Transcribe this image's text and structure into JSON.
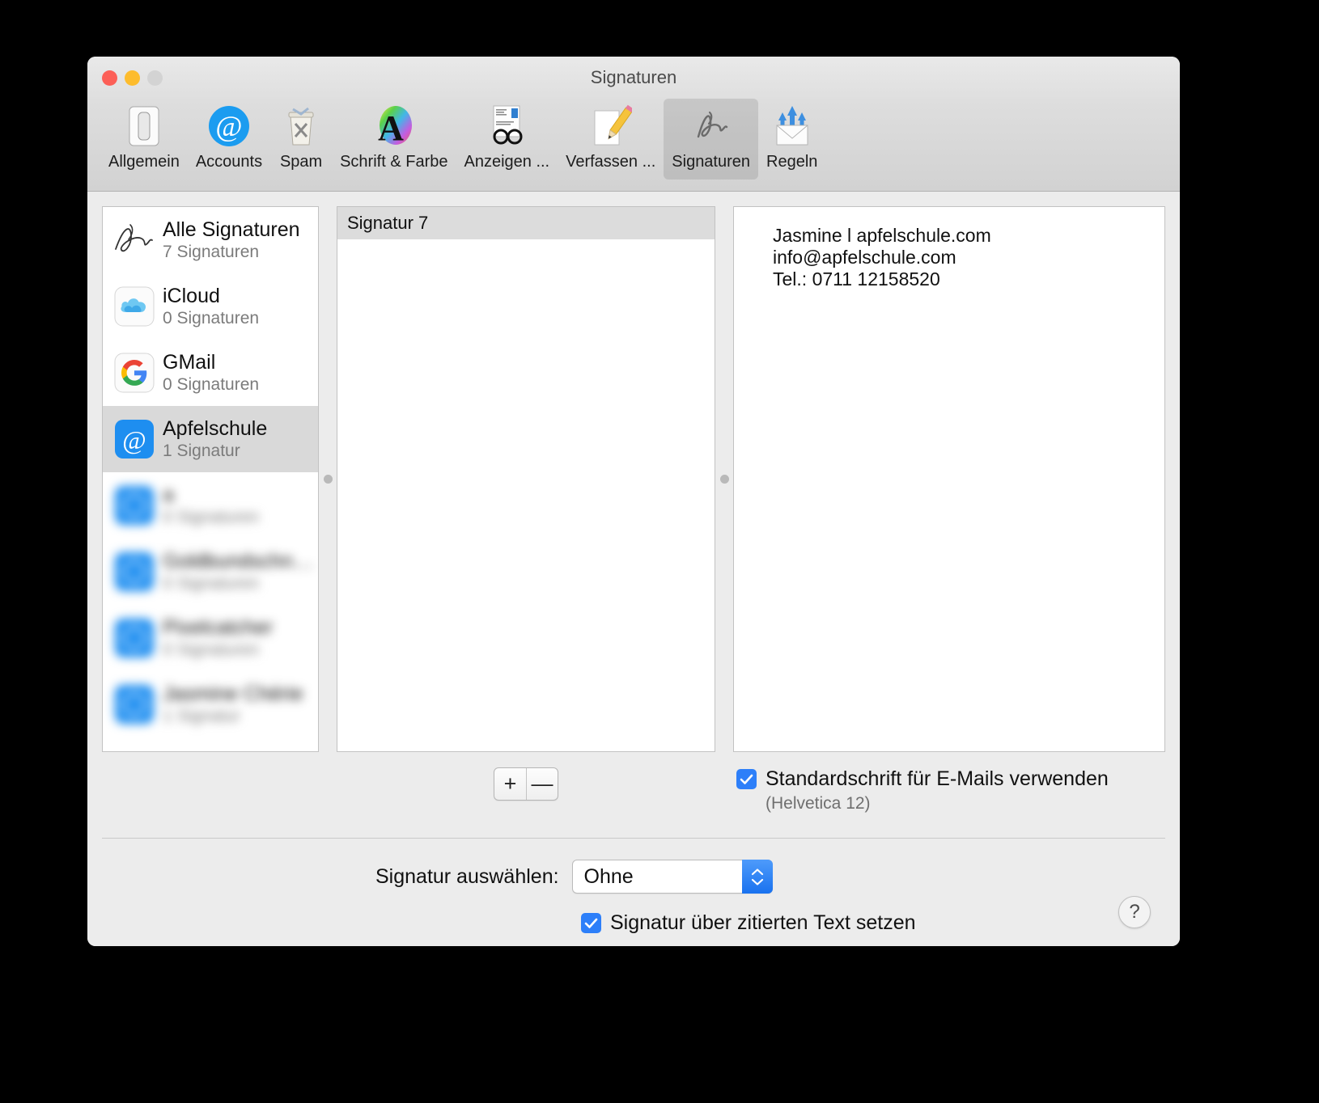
{
  "window": {
    "title": "Signaturen",
    "traffic_lights": [
      "close",
      "minimize",
      "zoom"
    ]
  },
  "toolbar": {
    "items": [
      {
        "label": "Allgemein",
        "icon": "switch-icon",
        "selected": false
      },
      {
        "label": "Accounts",
        "icon": "at-sign-icon",
        "selected": false
      },
      {
        "label": "Spam",
        "icon": "trash-icon",
        "selected": false
      },
      {
        "label": "Schrift & Farbe",
        "icon": "font-color-icon",
        "selected": false
      },
      {
        "label": "Anzeigen ...",
        "icon": "viewing-icon",
        "selected": false
      },
      {
        "label": "Verfassen ...",
        "icon": "pencil-icon",
        "selected": false
      },
      {
        "label": "Signaturen",
        "icon": "signature-icon",
        "selected": true
      },
      {
        "label": "Regeln",
        "icon": "rules-icon",
        "selected": false
      }
    ]
  },
  "sidebar": {
    "accounts": [
      {
        "name": "Alle Signaturen",
        "count": "7 Signaturen",
        "icon": "signature-scribble-icon",
        "selected": false,
        "blurred": false
      },
      {
        "name": "iCloud",
        "count": "0 Signaturen",
        "icon": "icloud-icon",
        "selected": false,
        "blurred": false
      },
      {
        "name": "GMail",
        "count": "0 Signaturen",
        "icon": "google-icon",
        "selected": false,
        "blurred": false
      },
      {
        "name": "Apfelschule",
        "count": "1 Signatur",
        "icon": "at-sign-blue-icon",
        "selected": true,
        "blurred": false
      },
      {
        "name": "a",
        "count": "0 Signaturen",
        "icon": "mail-account-icon",
        "selected": false,
        "blurred": true
      },
      {
        "name": "Goldbundschnu...",
        "count": "0 Signaturen",
        "icon": "mail-account-icon",
        "selected": false,
        "blurred": true
      },
      {
        "name": "Pixelcatcher",
        "count": "0 Signaturen",
        "icon": "mail-account-icon",
        "selected": false,
        "blurred": true
      },
      {
        "name": "Jasmine Chérie",
        "count": "1 Signatur",
        "icon": "mail-account-icon",
        "selected": false,
        "blurred": true
      }
    ]
  },
  "signature_list": {
    "items": [
      {
        "name": "Signatur 7",
        "selected": true
      }
    ],
    "add_label": "+",
    "remove_label": "—"
  },
  "preview": {
    "lines": [
      "Jasmine l apfelschule.com",
      "info@apfelschule.com",
      "Tel.: 0711 12158520"
    ]
  },
  "options": {
    "default_font_checkbox": {
      "label": "Standardschrift für E-Mails verwenden",
      "checked": true,
      "sub_label": "(Helvetica 12)"
    }
  },
  "bottom": {
    "select_signature_label": "Signatur auswählen:",
    "select_signature_value": "Ohne",
    "select_signature_options": [
      "Ohne"
    ],
    "quote_checkbox": {
      "label": "Signatur über zitierten Text setzen",
      "checked": true
    },
    "help_label": "?"
  },
  "colors": {
    "accent": "#2d7ff9",
    "window_bg": "#ececec",
    "selected_row": "#d9d9d9"
  }
}
